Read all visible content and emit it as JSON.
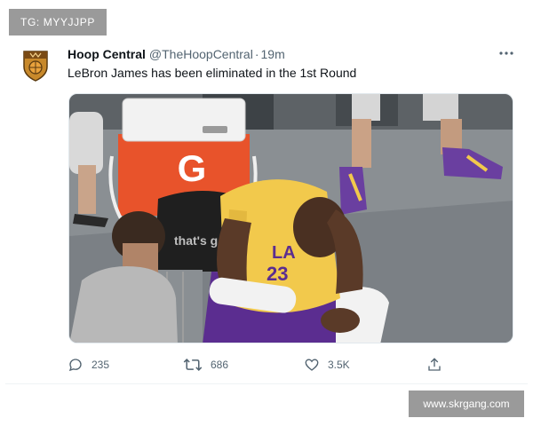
{
  "watermarks": {
    "top": "TG: MYYJJPP",
    "bottom": "www.skrgang.com"
  },
  "tweet": {
    "author_name": "Hoop Central",
    "handle": "@TheHoopCentral",
    "separator": "·",
    "time": "19m",
    "text": "LeBron James has been eliminated in the 1st Round",
    "media": {
      "cooler_text": "G",
      "chair_text": "that's g",
      "jersey_text": "LA",
      "jersey_number": "23"
    },
    "actions": {
      "replies": "235",
      "retweets": "686",
      "likes": "3.5K"
    }
  },
  "icons": [
    "more-icon",
    "reply-icon",
    "retweet-icon",
    "like-icon",
    "share-icon"
  ],
  "colors": {
    "lakers_gold": "#f2c94c",
    "lakers_purple": "#5b2d90",
    "gatorade_orange": "#e8532b",
    "text_secondary": "#536471"
  }
}
